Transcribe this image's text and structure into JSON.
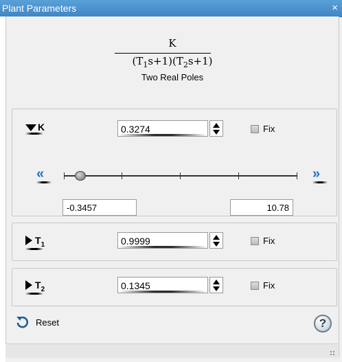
{
  "window": {
    "title": "Plant Parameters",
    "close_glyph": "×"
  },
  "formula": {
    "numerator": "K",
    "den_p1": "(T",
    "den_s1": "1",
    "den_p2": "s+1)(T",
    "den_s2": "2",
    "den_p3": "s+1)",
    "caption": "Two Real Poles"
  },
  "params": {
    "k": {
      "label": "K",
      "value": "0.3274",
      "fix_label": "Fix",
      "fixed": false,
      "slider": {
        "min_label": "-0.3457",
        "max_label": "10.78",
        "position_fraction": 0.06
      },
      "left_chevron": "«",
      "right_chevron": "»"
    },
    "t1": {
      "label": "T",
      "sub": "1",
      "value": "0.9999",
      "fix_label": "Fix",
      "fixed": false
    },
    "t2": {
      "label": "T",
      "sub": "2",
      "value": "0.1345",
      "fix_label": "Fix",
      "fixed": false
    }
  },
  "footer": {
    "reset_label": "Reset",
    "help_glyph": "?"
  },
  "icons": {
    "expand_down": "triangle-down-icon",
    "expand_right": "triangle-right-icon",
    "reset": "reset-arrow-icon",
    "help": "help-icon"
  },
  "colors": {
    "titlebar": "#4a93d0",
    "chevron": "#1f6fc2"
  }
}
